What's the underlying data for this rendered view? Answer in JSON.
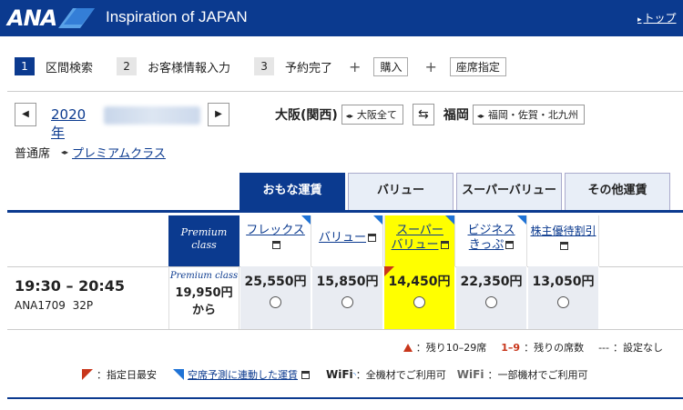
{
  "header": {
    "brand": "ANA",
    "title": "Inspiration of JAPAN",
    "link": "トップ"
  },
  "steps": [
    {
      "num": "1",
      "label": "区間検索"
    },
    {
      "num": "2",
      "label": "お客様情報入力"
    },
    {
      "num": "3",
      "label": "予約完了"
    }
  ],
  "step_extras": [
    "購入",
    "座席指定"
  ],
  "date": {
    "year": "2020年"
  },
  "route": {
    "origin": "大阪(関西)",
    "origin_pill": "大阪全て",
    "destination": "福岡",
    "destination_pill": "福岡・佐賀・北九州"
  },
  "seat_class": {
    "current": "普通席",
    "alternate": "プレミアムクラス"
  },
  "tabs": [
    "おもな運賃",
    "バリュー",
    "スーパーバリュー",
    "その他運賃"
  ],
  "fare_headers": {
    "premium": [
      "Premium",
      "class"
    ],
    "fares": [
      {
        "line1": "フレックス",
        "line2": ""
      },
      {
        "line1": "バリュー",
        "line2": ""
      },
      {
        "line1": "スーパー",
        "line2": "バリュー"
      },
      {
        "line1": "ビジネス",
        "line2": "きっぷ"
      },
      {
        "line1": "株主優待割引",
        "line2": ""
      }
    ]
  },
  "flight": {
    "time": "19:30 – 20:45",
    "number": "ANA1709",
    "aircraft": "32P",
    "premium_label": "Premium class",
    "premium_price": "19,950円",
    "premium_from": "から",
    "prices": [
      "25,550円",
      "15,850円",
      "14,450円",
      "22,350円",
      "13,050円"
    ]
  },
  "legend": {
    "few_seats": "：残り10–29席",
    "count_marker": "1–9",
    "count_text": "：残りの席数",
    "dash_marker": "---",
    "dash_text": "：設定なし",
    "red_text": "：指定日最安",
    "blue_link": "空席予測に連動した運賃",
    "wifi_label": "WiFi",
    "wifi_all": "：全機材でご利用可",
    "wifi_some": "：一部機材でご利用可"
  },
  "colors": {
    "brand": "#0b3a8f",
    "highlight": "#ffff00",
    "red": "#c8361b",
    "blue": "#1f73d6"
  }
}
